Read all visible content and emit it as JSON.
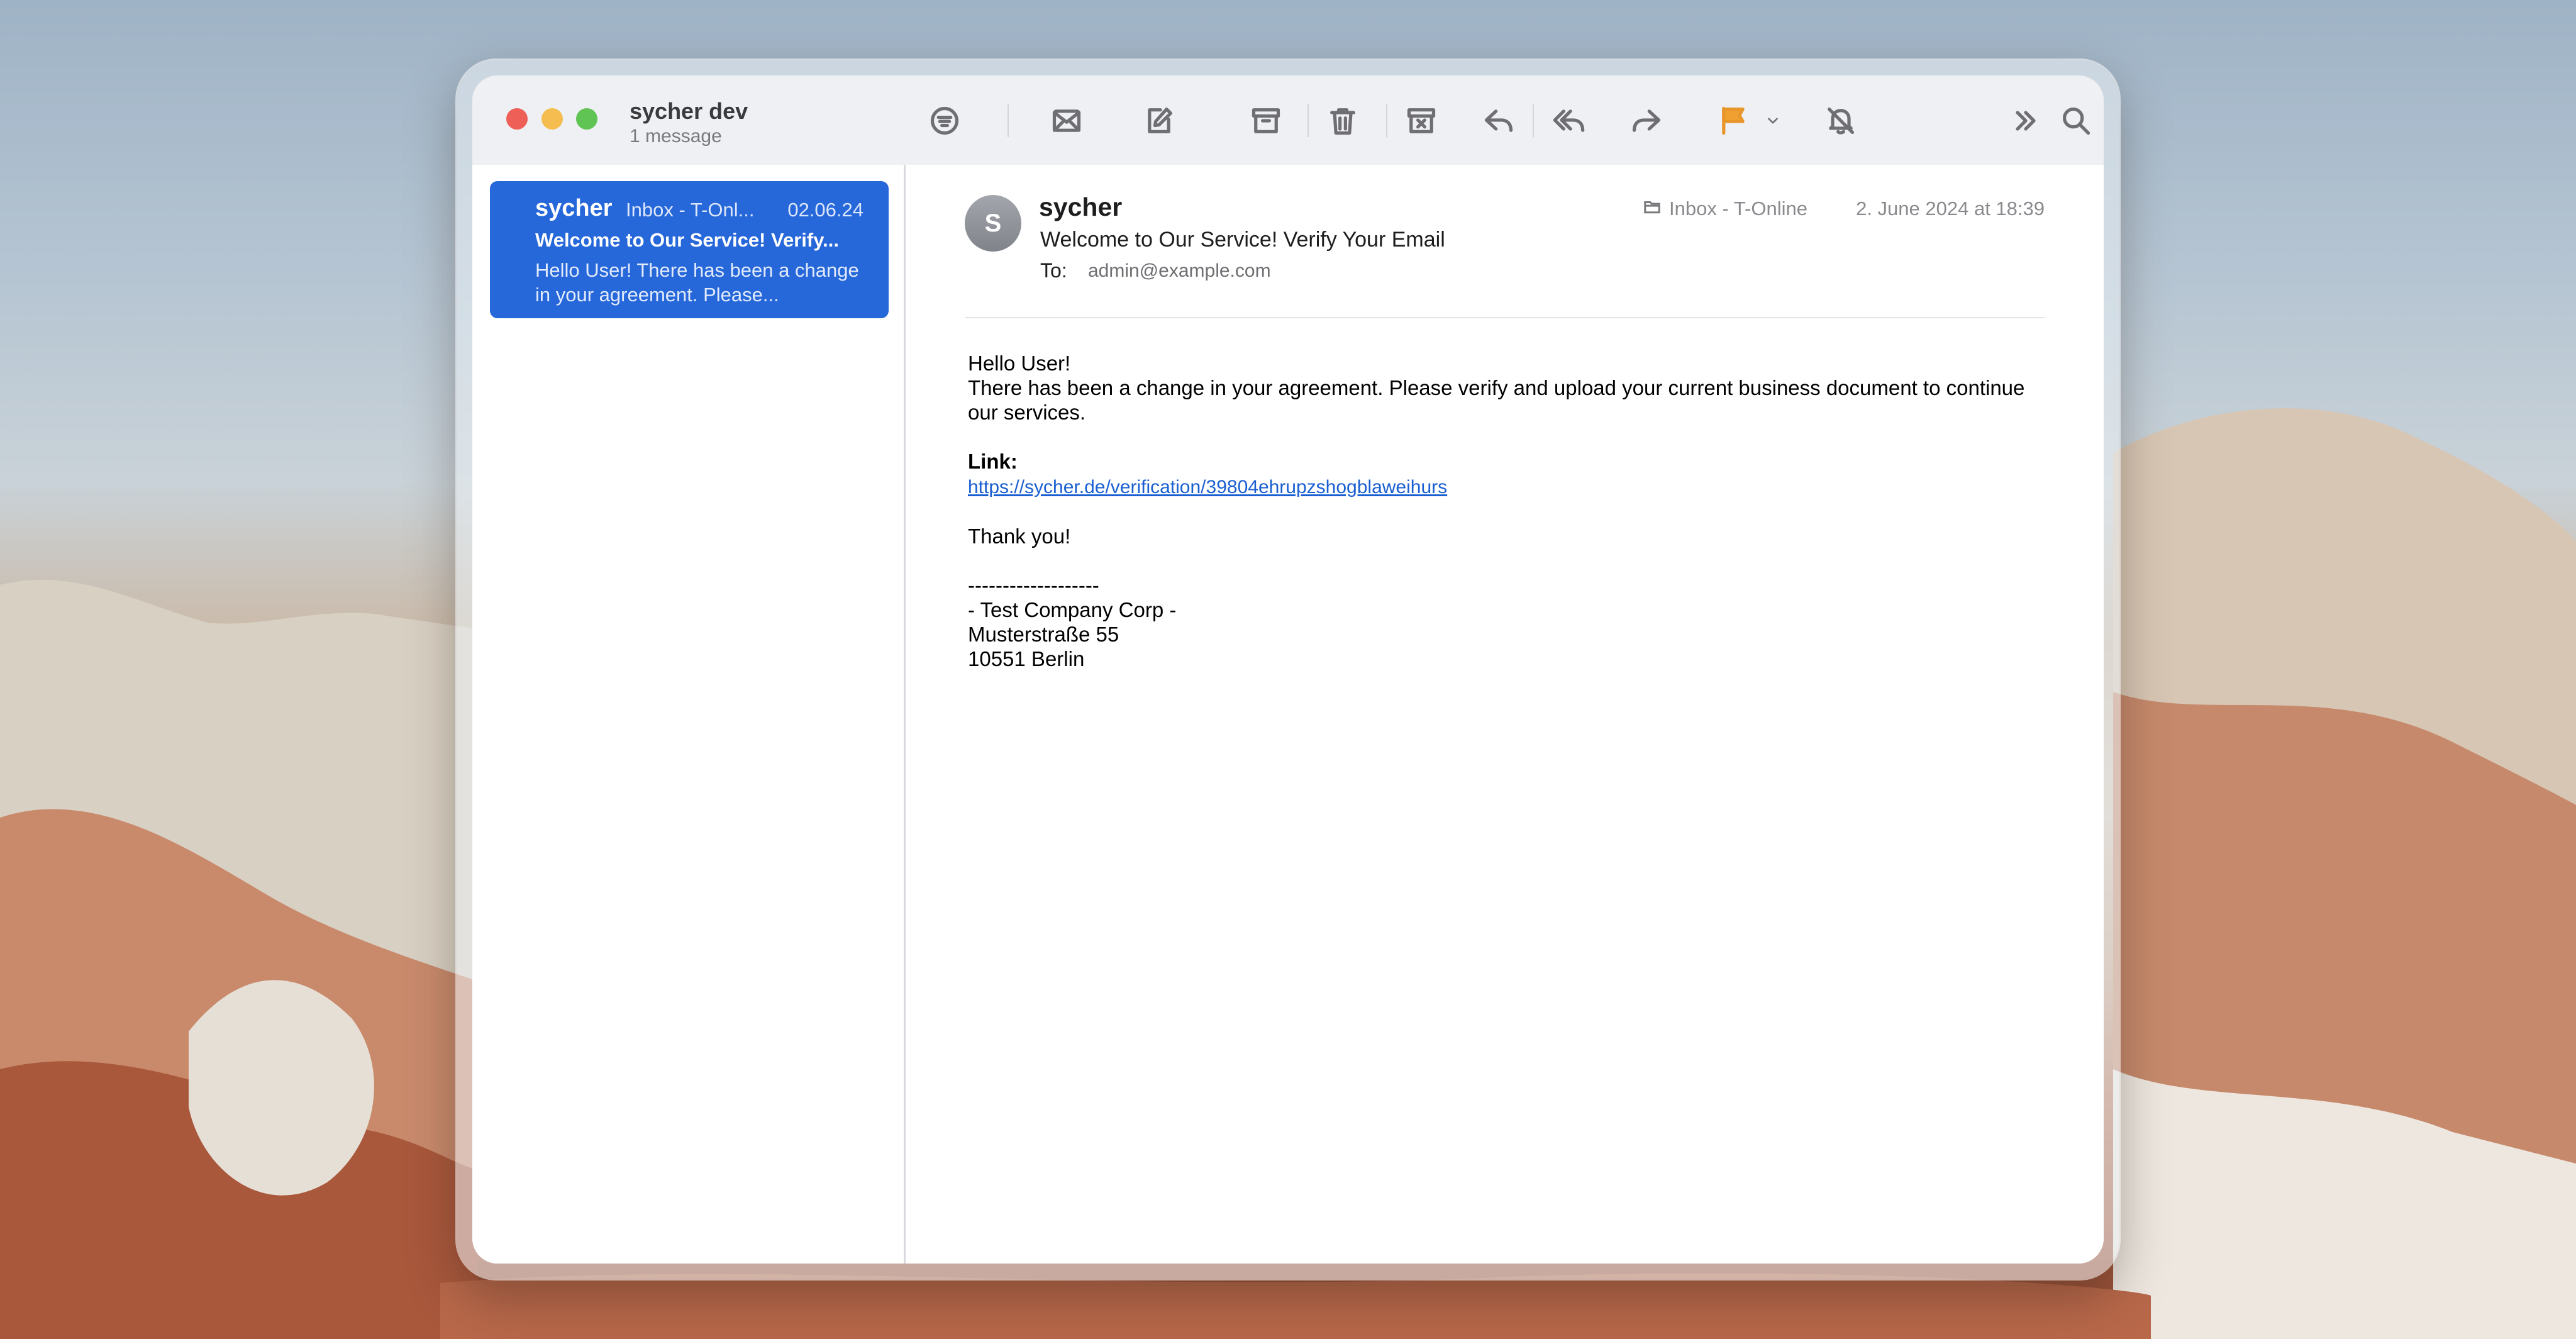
{
  "window": {
    "title": "sycher dev",
    "subtitle": "1 message"
  },
  "toolbar": {
    "icons": [
      "filter-icon",
      "get-mail-icon",
      "compose-icon",
      "archive-icon",
      "trash-icon",
      "junk-icon",
      "reply-icon",
      "reply-all-icon",
      "forward-icon",
      "flag-icon",
      "flag-menu-chevron-icon",
      "mute-icon",
      "more-icon",
      "search-icon"
    ],
    "flag_color": "#f0a030"
  },
  "message_list": {
    "items": [
      {
        "sender": "sycher",
        "mailbox": "Inbox - T-Onl...",
        "date": "02.06.24",
        "subject": "Welcome to Our Service! Verify...",
        "preview": "Hello User! There has been a change in your agreement. Please...",
        "selected": true
      }
    ],
    "selected_color": "#2667d9"
  },
  "reader": {
    "avatar_initial": "S",
    "sender": "sycher",
    "subject": "Welcome to Our Service! Verify Your Email",
    "to_label": "To:",
    "to": "admin@example.com",
    "mailbox": "Inbox - T-Online",
    "date": "2. June 2024 at 18:39",
    "body": {
      "greeting": "Hello User!",
      "paragraph": "There has been a change in your agreement. Please verify and upload your current business document to continue our services.",
      "link_label": "Link:",
      "link": "https://sycher.de/verification/39804ehrupzshogblaweihurs",
      "closing": "Thank you!",
      "separator": "-------------------",
      "signature_company": "- Test Company Corp -",
      "signature_street": "Musterstraße 55",
      "signature_city": "10551 Berlin"
    }
  }
}
